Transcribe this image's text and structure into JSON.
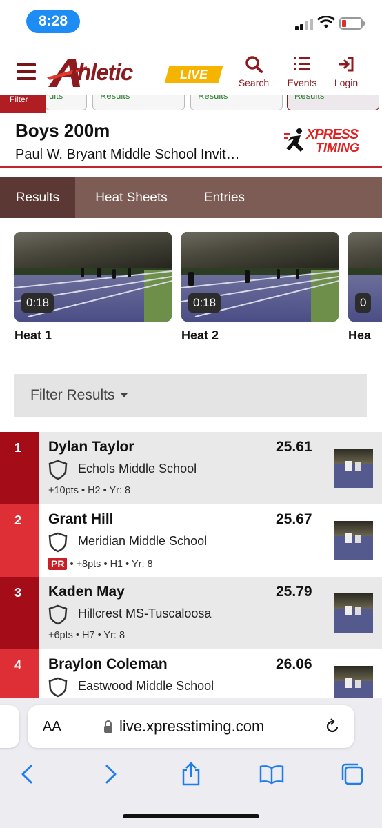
{
  "status_bar": {
    "time": "8:28"
  },
  "header": {
    "logo_main": "thletic",
    "logo_live": "LIVE",
    "nav": [
      {
        "label": "Search",
        "icon": "search-icon"
      },
      {
        "label": "Events",
        "icon": "events-list-icon"
      },
      {
        "label": "Login",
        "icon": "login-icon"
      }
    ],
    "colors": {
      "brand": "#8c1a1e",
      "accent": "#f5b400"
    }
  },
  "substrip": {
    "filter_label": "Filter",
    "pills": [
      "ults",
      "Results",
      "Results",
      "Results"
    ]
  },
  "event": {
    "title": "Boys 200m",
    "meet": "Paul W. Bryant Middle School Invit…",
    "timer_logo_top": "XPRESS",
    "timer_logo_bottom": "TIMING"
  },
  "tabs": [
    {
      "label": "Results",
      "active": true
    },
    {
      "label": "Heat Sheets",
      "active": false
    },
    {
      "label": "Entries",
      "active": false
    }
  ],
  "videos": [
    {
      "label": "Heat 1",
      "duration": "0:18"
    },
    {
      "label": "Heat 2",
      "duration": "0:18"
    },
    {
      "label": "Hea",
      "duration": "0"
    }
  ],
  "filter": {
    "label": "Filter Results"
  },
  "results": [
    {
      "place": "1",
      "name": "Dylan Taylor",
      "mark": "25.61",
      "school": "Echols Middle School",
      "pr": false,
      "details": "+10pts • H2 • Yr: 8"
    },
    {
      "place": "2",
      "name": "Grant Hill",
      "mark": "25.67",
      "school": "Meridian Middle School",
      "pr": true,
      "pr_label": "PR",
      "details": "• +8pts • H1 • Yr: 8"
    },
    {
      "place": "3",
      "name": "Kaden May",
      "mark": "25.79",
      "school": "Hillcrest MS-Tuscaloosa",
      "pr": false,
      "details": "+6pts • H7 • Yr: 8"
    },
    {
      "place": "4",
      "name": "Braylon Coleman",
      "mark": "26.06",
      "school": "Eastwood Middle School",
      "pr": false,
      "details": ""
    }
  ],
  "browser": {
    "text_size_label": "AA",
    "url": "live.xpresstiming.com",
    "toolbar": [
      "back-icon",
      "forward-icon",
      "share-icon",
      "bookmarks-icon",
      "tabs-icon"
    ]
  }
}
